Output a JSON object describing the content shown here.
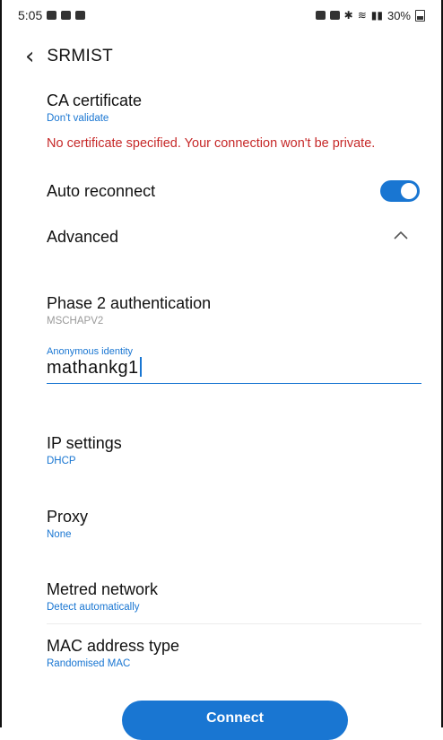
{
  "status_bar": {
    "time": "5:05",
    "left_icons": [
      "gallery-icon",
      "notification-bell-icon",
      "twitter-icon"
    ],
    "right_icons": [
      "alarm-icon",
      "vibrate-icon",
      "bluetooth-icon",
      "wifi-icon",
      "volte-icon",
      "signal-icon"
    ],
    "battery": "30%"
  },
  "header": {
    "back_icon": "chevron-left-icon",
    "title": "SRMIST"
  },
  "ca_certificate": {
    "label": "CA certificate",
    "value": "Don't validate"
  },
  "warning": "No certificate specified. Your connection won't be private.",
  "auto_reconnect": {
    "label": "Auto reconnect",
    "enabled": true
  },
  "advanced": {
    "label": "Advanced",
    "expanded": true
  },
  "phase2": {
    "label": "Phase 2 authentication",
    "value": "MSCHAPV2"
  },
  "anonymous_identity": {
    "label": "Anonymous identity",
    "value": "mathankg1"
  },
  "ip_settings": {
    "label": "IP settings",
    "value": "DHCP"
  },
  "proxy": {
    "label": "Proxy",
    "value": "None"
  },
  "metered": {
    "label": "Metred network",
    "value": "Detect automatically"
  },
  "mac": {
    "label": "MAC address type",
    "value": "Randomised MAC"
  },
  "connect_button": "Connect",
  "colors": {
    "accent": "#1976d2",
    "warning": "#c62828"
  }
}
